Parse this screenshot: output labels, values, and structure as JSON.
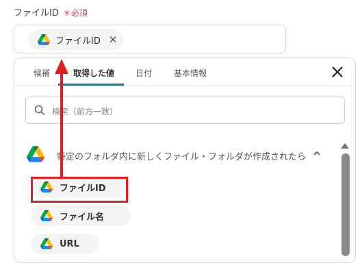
{
  "field": {
    "label": "ファイルID",
    "required_mark": "＊必須"
  },
  "input": {
    "chip_label": "ファイルID",
    "chip_icon": "google-drive-icon"
  },
  "panel": {
    "tabs": [
      {
        "label": "候補",
        "active": false
      },
      {
        "label": "取得した値",
        "active": true
      },
      {
        "label": "日付",
        "active": false
      },
      {
        "label": "基本情報",
        "active": false
      }
    ],
    "active_tab_color": "#2b6f86",
    "search_placeholder": "検索（前方一致）",
    "group": {
      "title": "特定のフォルダ内に新しくファイル・フォルダが作成されたら",
      "icon": "google-drive-icon",
      "expanded": true
    },
    "items": [
      {
        "label": "ファイルID",
        "icon": "google-drive-icon",
        "highlighted": true
      },
      {
        "label": "ファイル名",
        "icon": "google-drive-icon",
        "highlighted": false
      },
      {
        "label": "URL",
        "icon": "google-drive-icon",
        "highlighted": false
      }
    ]
  },
  "annotation": {
    "color": "#e02020"
  }
}
